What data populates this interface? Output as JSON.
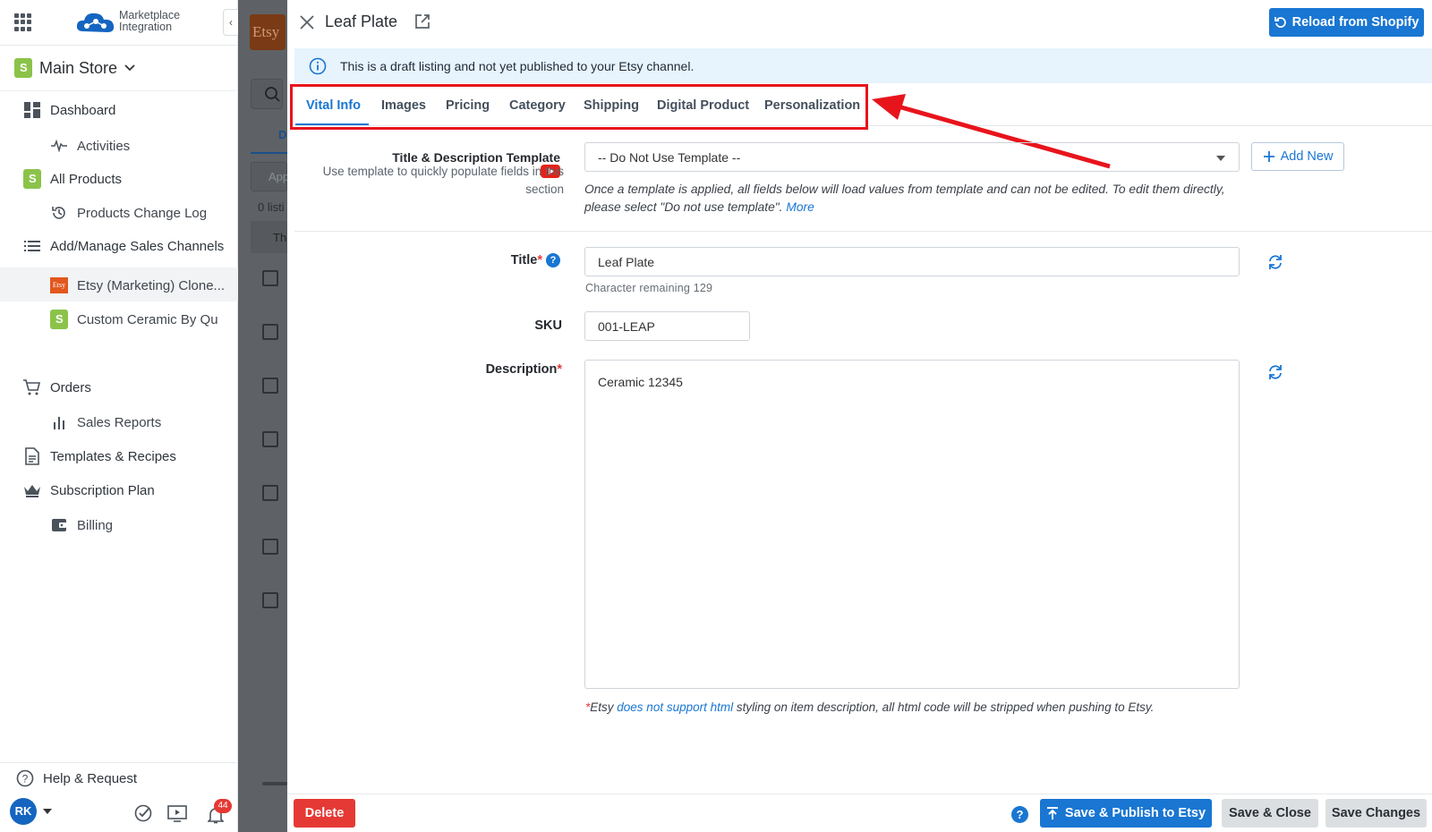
{
  "app": {
    "logo_line1": "Marketplace",
    "logo_line2": "Integration",
    "collapse_label": "‹",
    "store_name": "Main Store"
  },
  "sidebar": {
    "items": [
      {
        "label": "Dashboard",
        "icon": "dashboard-icon"
      },
      {
        "label": "Activities",
        "icon": "activity-icon"
      },
      {
        "label": "All Products",
        "icon": "shopify-icon"
      },
      {
        "label": "Products Change Log",
        "icon": "history-icon"
      },
      {
        "label": "Add/Manage Sales Channels",
        "icon": "list-icon"
      },
      {
        "label": "Etsy (Marketing) Clone...",
        "icon": "etsy-icon"
      },
      {
        "label": "Custom Ceramic By Qu",
        "icon": "shopify-icon"
      },
      {
        "label": "Orders",
        "icon": "cart-icon"
      },
      {
        "label": "Sales Reports",
        "icon": "bar-chart-icon"
      },
      {
        "label": "Templates & Recipes",
        "icon": "document-icon"
      },
      {
        "label": "Subscription Plan",
        "icon": "crown-icon"
      },
      {
        "label": "Billing",
        "icon": "wallet-icon"
      }
    ],
    "help": "Help & Request",
    "avatar": "RK",
    "notifications": "44"
  },
  "background": {
    "etsy_label": "Etsy",
    "tab_letter": "D",
    "search_placeholder": "App",
    "count_text": "0 listi",
    "header_text": "Th"
  },
  "panel": {
    "title": "Leaf Plate",
    "reload_button": "Reload from Shopify",
    "info_message": "This is a draft listing and not yet published to your Etsy channel.",
    "tabs": [
      "Vital Info",
      "Images",
      "Pricing",
      "Category",
      "Shipping",
      "Digital Product",
      "Personalization"
    ],
    "active_tab": "Vital Info",
    "template_label": "Title & Description Template",
    "template_hint_line1": "Use template to quickly populate fields in this",
    "template_hint_line2": "section",
    "template_value": "-- Do Not Use Template --",
    "add_new": "Add New",
    "template_note": "Once a template is applied, all fields below will load values from template and can not be edited. To edit them directly, please select \"Do not use template\".",
    "template_note_more": "More",
    "title_label": "Title",
    "title_value": "Leaf Plate",
    "title_hint": "Character remaining 129",
    "sku_label": "SKU",
    "sku_value": "001-LEAP",
    "description_label": "Description",
    "description_value": "Ceramic 12345",
    "footnote_prefix": "*Etsy ",
    "footnote_link": "does not support html",
    "footnote_suffix": " styling on item description, all html code will be stripped when pushing to Etsy.",
    "required_mark": "*",
    "help_mark": "?"
  },
  "footer": {
    "delete": "Delete",
    "publish": "Save & Publish to Etsy",
    "save_close": "Save & Close",
    "save_changes": "Save Changes"
  },
  "colors": {
    "accent": "#1976d2",
    "danger": "#e53935",
    "highlight": "#e8141c",
    "shopify_green": "#8bc34a",
    "etsy_orange": "#e2571e"
  }
}
